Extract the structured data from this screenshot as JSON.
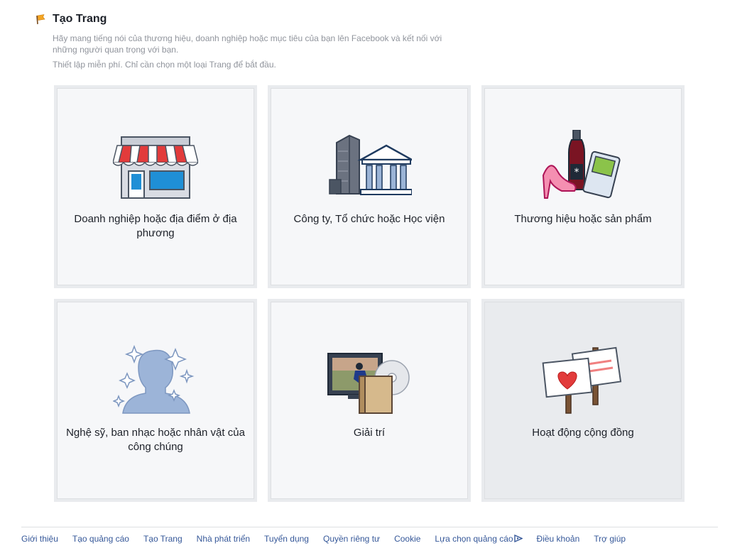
{
  "header": {
    "icon": "flag-icon",
    "title": "Tạo Trang",
    "description": "Hãy mang tiếng nói của thương hiệu, doanh nghiệp hoặc mục tiêu của bạn lên Facebook và kết nối với những người quan trọng với bạn.",
    "subtext": "Thiết lập miễn phí. Chỉ cần chọn một loại Trang để bắt đầu."
  },
  "categories": [
    {
      "label": "Doanh nghiệp hoặc địa điểm ở địa phương",
      "icon": "storefront-icon"
    },
    {
      "label": "Công ty, Tổ chức hoặc Học viện",
      "icon": "buildings-icon"
    },
    {
      "label": "Thương hiệu hoặc sản phẩm",
      "icon": "products-icon"
    },
    {
      "label": "Nghệ sỹ, ban nhạc hoặc nhân vật của công chúng",
      "icon": "public-figure-icon"
    },
    {
      "label": "Giải trí",
      "icon": "entertainment-icon"
    },
    {
      "label": "Hoạt động cộng đồng",
      "icon": "community-signs-icon"
    }
  ],
  "footer": {
    "links": [
      "Giới thiệu",
      "Tạo quảng cáo",
      "Tạo Trang",
      "Nhà phát triển",
      "Tuyển dụng",
      "Quyền riêng tư",
      "Cookie",
      "Lựa chọn quảng cáo",
      "Điều khoản",
      "Trợ giúp"
    ]
  },
  "colors": {
    "link": "#365899",
    "muted": "#90949c",
    "card_bg": "#f6f7f9",
    "card_border": "#e9ebee"
  }
}
